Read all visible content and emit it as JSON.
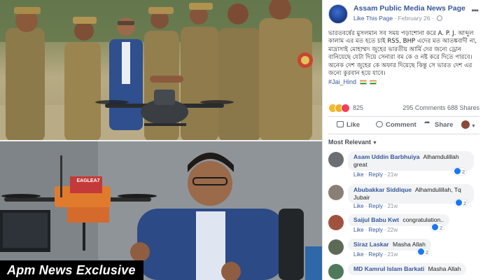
{
  "photos": {
    "top_alt": "",
    "exclusive_banner": "Apm News Exclusive",
    "drone_label": "EAGLEA7"
  },
  "post": {
    "page_name": "Assam Public Media News Page",
    "like_page": "Like This Page",
    "date": "February 26",
    "body": "ভারতবর্ষের মুসলমান সব সময় পড়াশোনা করে A. P. J. আব্দুল কালাম এর মত হতে চাই RSS, BHP এদের মত আতঙ্কবাদী না, মাদ্রাসাই মোহাম্মদ জুহের ভারতীয় আর্মি দের জন্যে ড্রোন বানিয়েছে যেটা দিয়ে সেনারা বম কে ও নষ্ট করে দিতে পারবে। অনেক দেশ জুহের কে অফার দিয়েছে কিন্তু সে ভারত দেশ এর জন্যে কুরবান হয়ে যাবে।",
    "hashtag": "#Jai_Hind"
  },
  "stats": {
    "reactions": "825",
    "comments": "295 Comments",
    "shares": "688 Shares"
  },
  "actions": {
    "like": "Like",
    "comment": "Comment",
    "share": "Share"
  },
  "comments_sort": "Most Relevant",
  "comments": [
    {
      "author": "Asam Uddin Barbhuiya",
      "text": "Alhamdulillah great",
      "like": "Like",
      "reply": "Reply",
      "time": "21w",
      "likes": "2",
      "avatar_color": "#6b6f74"
    },
    {
      "author": "Abubakkar Siddique",
      "text": "Alhamdulillah, Tq Jubair",
      "like": "Like",
      "reply": "Reply",
      "time": "21w",
      "likes": "2",
      "avatar_color": "#8a7f74"
    },
    {
      "author": "Saijul Babu Kwt",
      "text": "congratulation..",
      "like": "Like",
      "reply": "Reply",
      "time": "22w",
      "likes": "2",
      "avatar_color": "#a0523f"
    },
    {
      "author": "Siraz Laskar",
      "text": "Masha Allah",
      "like": "Like",
      "reply": "Reply",
      "time": "21w",
      "likes": "2",
      "avatar_color": "#5d6a55"
    },
    {
      "author": "MD Kamrul Islam Barkati",
      "text": "Masha Allah",
      "like": "",
      "reply": "",
      "time": "",
      "likes": "",
      "avatar_color": "#4f7a5a"
    }
  ],
  "colors": {
    "link_blue": "#365899",
    "meta_gray": "#90949c",
    "banner_black": "#000000",
    "bubble_gray": "#f2f3f5"
  }
}
